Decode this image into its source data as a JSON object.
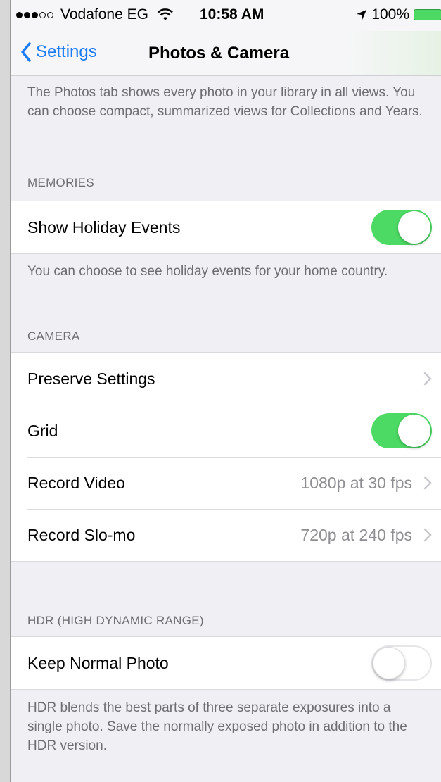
{
  "status_bar": {
    "carrier": "Vodafone EG",
    "time": "10:58 AM",
    "battery": "100%",
    "signal_bars": 3,
    "signal_total": 5
  },
  "nav": {
    "back_label": "Settings",
    "title": "Photos & Camera"
  },
  "intro_text": "The Photos tab shows every photo in your library in all views. You can choose compact, summarized views for Collections and Years.",
  "memories": {
    "header": "MEMORIES",
    "show_holiday_events": {
      "label": "Show Holiday Events",
      "on": true
    },
    "footer": "You can choose to see holiday events for your home country."
  },
  "camera": {
    "header": "CAMERA",
    "preserve_settings": {
      "label": "Preserve Settings"
    },
    "grid": {
      "label": "Grid",
      "on": true
    },
    "record_video": {
      "label": "Record Video",
      "value": "1080p at 30 fps"
    },
    "record_slomo": {
      "label": "Record Slo-mo",
      "value": "720p at 240 fps"
    }
  },
  "hdr": {
    "header": "HDR (HIGH DYNAMIC RANGE)",
    "keep_normal_photo": {
      "label": "Keep Normal Photo",
      "on": false
    },
    "footer": "HDR blends the best parts of three separate exposures into a single photo. Save the normally exposed photo in addition to the HDR version."
  },
  "colors": {
    "accent": "#1a7cf5",
    "toggle_on": "#4cd964",
    "group_background": "#efeff4",
    "secondary_text": "#6d6d72"
  },
  "icons": [
    "wifi-icon",
    "location-arrow-icon",
    "battery-icon",
    "chevron-left-icon",
    "chevron-right-icon"
  ]
}
